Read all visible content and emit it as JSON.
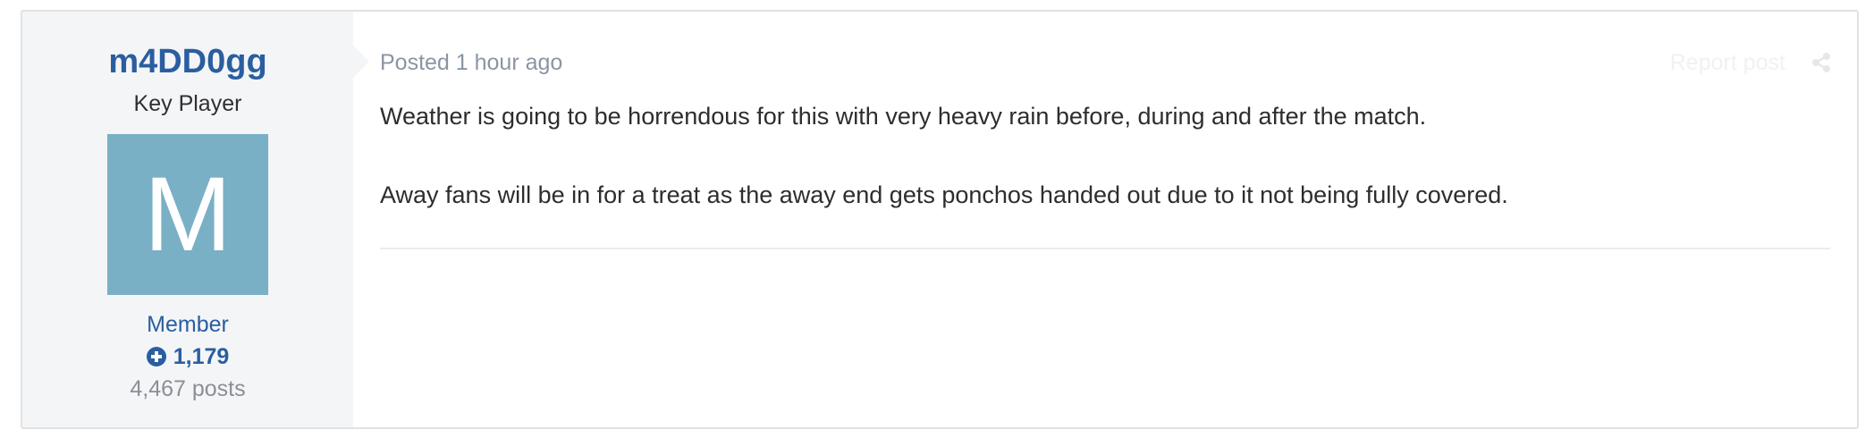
{
  "author": {
    "username": "m4DD0gg",
    "rank_title": "Key Player",
    "avatar_letter": "M",
    "avatar_color": "#79b0c6",
    "group": "Member",
    "reputation": "1,179",
    "posts": "4,467 posts"
  },
  "post": {
    "meta": "Posted 1 hour ago",
    "report_label": "Report post",
    "share_icon": "share-icon",
    "paragraphs": [
      "Weather is going to be horrendous for this with very heavy rain before, during and after the match.",
      "Away fans will be in for a treat as the away end gets ponchos handed out due to it not being fully covered."
    ]
  },
  "colors": {
    "link_blue": "#2a5ea0",
    "author_panel_bg": "#f4f5f7",
    "meta_gray": "#8a95a3"
  }
}
